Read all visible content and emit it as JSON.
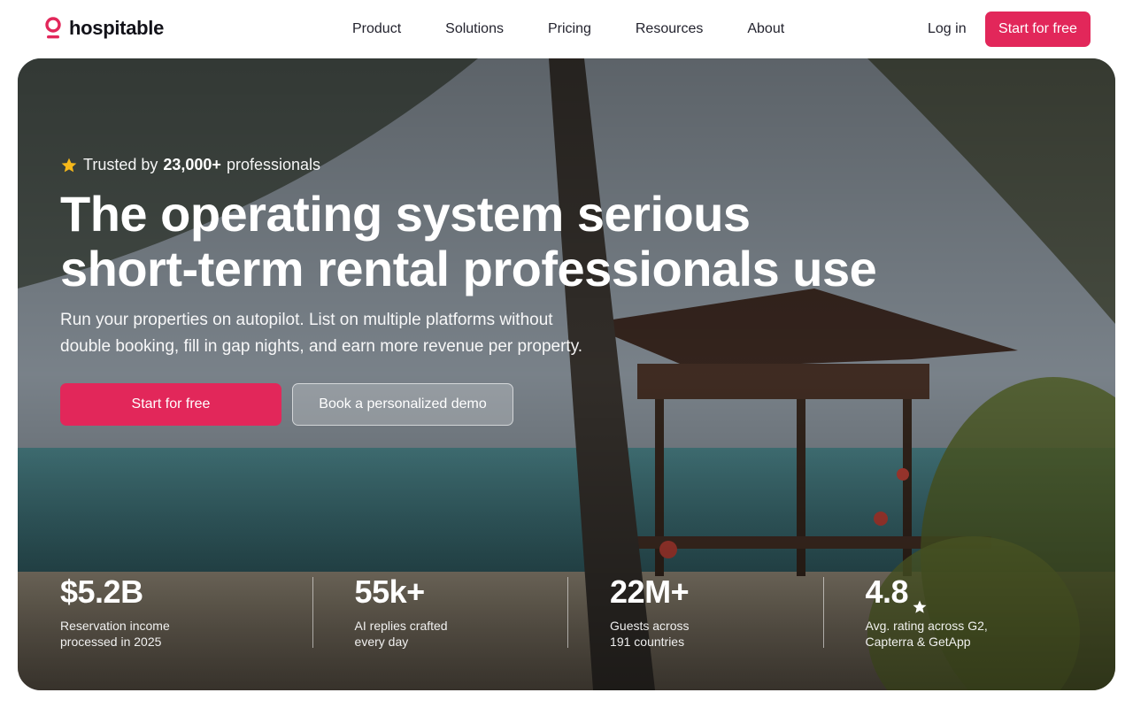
{
  "brand": {
    "name": "hospitable",
    "accent": "#e2275a"
  },
  "nav": {
    "items": [
      {
        "label": "Product"
      },
      {
        "label": "Solutions"
      },
      {
        "label": "Pricing"
      },
      {
        "label": "Resources"
      },
      {
        "label": "About"
      }
    ],
    "login_label": "Log in",
    "cta_label": "Start for free"
  },
  "hero": {
    "trusted_prefix": "Trusted by",
    "trusted_count": "23,000+",
    "trusted_suffix": "professionals",
    "headline_line1": "The operating system serious",
    "headline_line2": "short-term rental professionals use",
    "subline_line1": "Run your properties on autopilot. List on multiple platforms without",
    "subline_line2": "double booking, fill in gap nights, and earn more revenue per property.",
    "primary_cta": "Start for free",
    "secondary_cta": "Book a personalized demo",
    "icons": {
      "trusted": "star-icon",
      "rating": "star-icon"
    }
  },
  "stats": [
    {
      "value": "$5.2B",
      "label_line1": "Reservation income",
      "label_line2": "processed in 2025"
    },
    {
      "value": "55k+",
      "label_line1": "AI replies crafted",
      "label_line2": "every day"
    },
    {
      "value": "22M+",
      "label_line1": "Guests across",
      "label_line2": "191 countries"
    },
    {
      "value": "4.8",
      "label_line1": "Avg. rating across G2,",
      "label_line2": "Capterra & GetApp"
    }
  ]
}
